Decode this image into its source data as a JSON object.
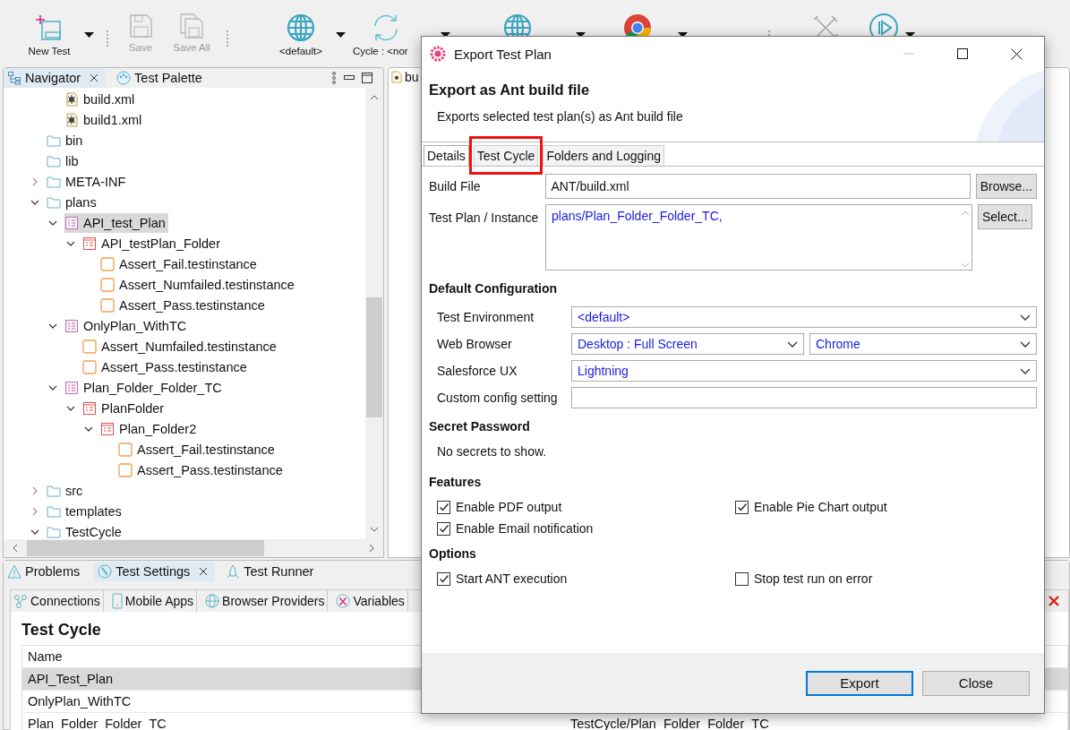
{
  "toolbar": [
    {
      "kind": "new",
      "label": "New Test",
      "dropdown": true,
      "disabled": false
    },
    {
      "kind": "save",
      "label": "Save",
      "disabled": true
    },
    {
      "kind": "saveall",
      "label": "Save All",
      "disabled": true
    },
    {
      "kind": "globe",
      "label": "<default>",
      "dropdown": true,
      "disabled": false
    },
    {
      "kind": "cycle",
      "label": "Cycle : <nor",
      "dropdown": true,
      "disabled": false
    },
    {
      "kind": "globe2",
      "dropdown": true,
      "disabled": false
    },
    {
      "kind": "chrome",
      "dropdown": true,
      "disabled": false
    },
    {
      "kind": "tools",
      "disabled": true
    },
    {
      "kind": "play",
      "dropdown": true,
      "disabled": false
    }
  ],
  "navigator": {
    "tabs": [
      {
        "label": "Navigator",
        "kind": "navigator",
        "selected": true,
        "closable": true
      },
      {
        "label": "Test Palette",
        "kind": "palette",
        "selected": false,
        "closable": false
      }
    ],
    "tree_partial": [
      {
        "label": "build.xml",
        "kind": "xml",
        "selected": false
      },
      {
        "label": "build1.xml",
        "kind": "xml",
        "selected": false
      }
    ],
    "tree": [
      {
        "label": "bin",
        "kind": "folder",
        "selected": false
      },
      {
        "label": "lib",
        "kind": "folder",
        "selected": false
      },
      {
        "label": "META-INF",
        "kind": "folder",
        "selected": false,
        "expanded": false
      },
      {
        "label": "plans",
        "kind": "folder",
        "selected": false,
        "expanded": true,
        "children": [
          {
            "label": "API_test_Plan",
            "kind": "plan",
            "selected": true,
            "expanded": true,
            "children": [
              {
                "label": "API_testPlan_Folder",
                "kind": "planfolder",
                "selected": false,
                "expanded": true,
                "children": [
                  {
                    "label": "Assert_Fail.testinstance",
                    "kind": "instance",
                    "selected": false
                  },
                  {
                    "label": "Assert_Numfailed.testinstance",
                    "kind": "instance",
                    "selected": false
                  },
                  {
                    "label": "Assert_Pass.testinstance",
                    "kind": "instance",
                    "selected": false
                  }
                ]
              }
            ]
          },
          {
            "label": "OnlyPlan_WithTC",
            "kind": "plan",
            "selected": false,
            "expanded": true,
            "children": [
              {
                "label": "Assert_Numfailed.testinstance",
                "kind": "instance",
                "selected": false
              },
              {
                "label": "Assert_Pass.testinstance",
                "kind": "instance",
                "selected": false
              }
            ]
          },
          {
            "label": "Plan_Folder_Folder_TC",
            "kind": "plan",
            "selected": false,
            "expanded": true,
            "children": [
              {
                "label": "PlanFolder",
                "kind": "planfolder",
                "selected": false,
                "expanded": true,
                "children": [
                  {
                    "label": "Plan_Folder2",
                    "kind": "planfolder",
                    "selected": false,
                    "expanded": true,
                    "children": [
                      {
                        "label": "Assert_Fail.testinstance",
                        "kind": "instance",
                        "selected": false
                      },
                      {
                        "label": "Assert_Pass.testinstance",
                        "kind": "instance",
                        "selected": false
                      }
                    ]
                  }
                ]
              }
            ]
          }
        ]
      },
      {
        "label": "src",
        "kind": "folder",
        "selected": false,
        "expanded": false
      },
      {
        "label": "templates",
        "kind": "folder",
        "selected": false,
        "expanded": false
      },
      {
        "label": "TestCycle",
        "kind": "folder",
        "selected": false,
        "expanded": true
      }
    ]
  },
  "editor": {
    "tab": "bu"
  },
  "bottom": {
    "tabs": [
      {
        "label": "Problems",
        "kind": "problems",
        "selected": false,
        "closable": false
      },
      {
        "label": "Test Settings",
        "kind": "settings",
        "selected": true,
        "closable": true
      },
      {
        "label": "Test Runner",
        "kind": "runner",
        "selected": false,
        "closable": false
      }
    ],
    "subtabs": [
      {
        "label": "Connections",
        "kind": "connections"
      },
      {
        "label": "Mobile Apps",
        "kind": "mobile"
      },
      {
        "label": "Browser Providers",
        "kind": "browser"
      },
      {
        "label": "Variables",
        "kind": "variables"
      }
    ],
    "heading": "Test Cycle",
    "table": {
      "columns": [
        "Name"
      ],
      "rows": [
        {
          "cells": [
            "API_Test_Plan"
          ],
          "selected": true
        },
        {
          "cells": [
            "OnlyPlan_WithTC"
          ],
          "selected": false
        },
        {
          "cells": [
            "Plan_Folder_Folder_TC",
            "TestCycle/Plan_Folder_Folder_TC"
          ],
          "selected": false
        }
      ]
    }
  },
  "dialog": {
    "title": "Export Test Plan",
    "heading": "Export as Ant build file",
    "description": "Exports selected test plan(s) as Ant build file",
    "tabs": [
      {
        "label": "Details",
        "selected": true,
        "highlighted": false
      },
      {
        "label": "Test Cycle",
        "selected": false,
        "highlighted": true
      },
      {
        "label": "Folders and Logging",
        "selected": false,
        "highlighted": false
      }
    ],
    "build_file": {
      "label": "Build File",
      "value": "ANT/build.xml",
      "button": "Browse..."
    },
    "test_plan": {
      "label": "Test Plan / Instance",
      "value": "plans/Plan_Folder_Folder_TC,",
      "button": "Select..."
    },
    "sections": [
      {
        "title": "Default Configuration",
        "kind": "config",
        "rows": [
          {
            "label": "Test Environment",
            "kind": "select",
            "fields": [
              "<default>"
            ]
          },
          {
            "label": "Web Browser",
            "kind": "select",
            "fields": [
              "Desktop : Full Screen",
              "Chrome"
            ]
          },
          {
            "label": "Salesforce UX",
            "kind": "select",
            "fields": [
              "Lightning"
            ]
          },
          {
            "label": "Custom config setting",
            "kind": "input"
          }
        ]
      },
      {
        "title": "Secret Password",
        "kind": "text",
        "text": "No secrets to show."
      },
      {
        "title": "Features",
        "kind": "checks",
        "items": [
          {
            "label": "Enable PDF output",
            "checked": true
          },
          {
            "label": "Enable Pie Chart output",
            "checked": true
          },
          {
            "label": "Enable Email notification",
            "checked": true
          }
        ]
      },
      {
        "title": "Options",
        "kind": "checks",
        "items": [
          {
            "label": "Start ANT execution",
            "checked": true
          },
          {
            "label": "Stop test run on error",
            "checked": false
          }
        ]
      }
    ],
    "buttons": [
      {
        "label": "Export",
        "default": true
      },
      {
        "label": "Close",
        "default": false
      }
    ]
  }
}
